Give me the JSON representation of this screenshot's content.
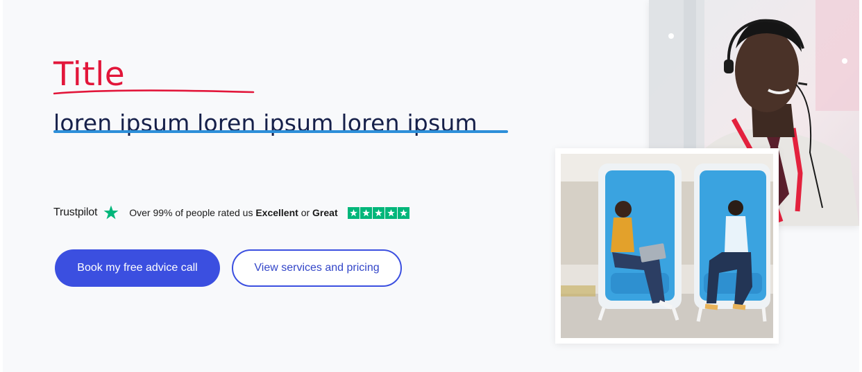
{
  "hero": {
    "title": "Title",
    "subtitle": "loren ipsum loren ipsum loren ipsum"
  },
  "trustpilot": {
    "brand": "Trustpilot",
    "text_prefix": "Over 99% of people rated us ",
    "excellent": "Excellent",
    "text_or": " or ",
    "great": "Great",
    "rating_stars": 5
  },
  "buttons": {
    "primary_label": "Book my free advice call",
    "secondary_label": "View services and pricing"
  },
  "colors": {
    "title": "#e2163a",
    "subtitle_underline": "#2d8fd9",
    "primary_button": "#3b4fe0",
    "trustpilot_green": "#00b67a"
  },
  "images": {
    "back_photo_icon": "call-center-agent-with-headset-photo",
    "front_photo_icon": "people-in-office-pods-photo"
  }
}
